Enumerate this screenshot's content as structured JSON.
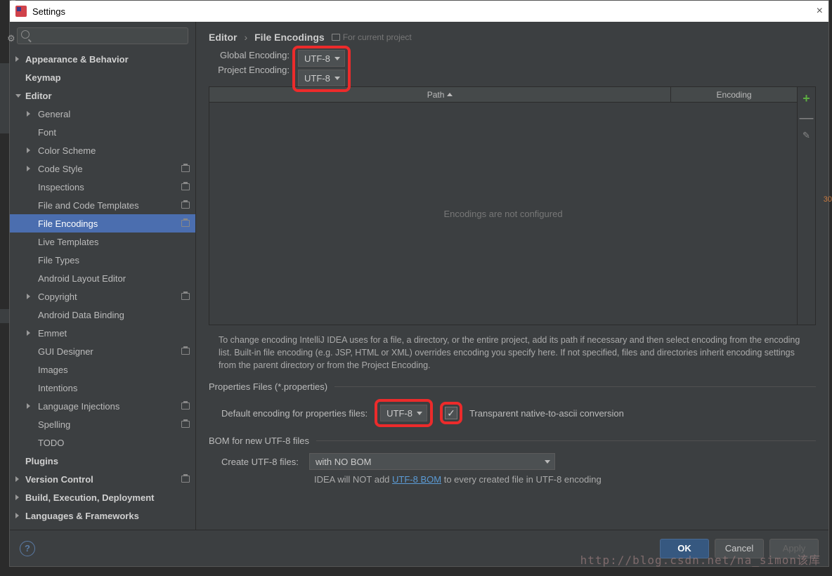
{
  "window": {
    "title": "Settings"
  },
  "search": {
    "placeholder": ""
  },
  "sidebar": {
    "items": [
      {
        "label": "Appearance & Behavior",
        "bold": true,
        "arrow": "right",
        "depth": 0
      },
      {
        "label": "Keymap",
        "bold": true,
        "depth": 0
      },
      {
        "label": "Editor",
        "bold": true,
        "arrow": "down",
        "depth": 0
      },
      {
        "label": "General",
        "arrow": "right",
        "depth": 1
      },
      {
        "label": "Font",
        "depth": 1
      },
      {
        "label": "Color Scheme",
        "arrow": "right",
        "depth": 1
      },
      {
        "label": "Code Style",
        "arrow": "right",
        "depth": 1,
        "proj": true
      },
      {
        "label": "Inspections",
        "depth": 1,
        "proj": true
      },
      {
        "label": "File and Code Templates",
        "depth": 1,
        "proj": true
      },
      {
        "label": "File Encodings",
        "depth": 1,
        "proj": true,
        "selected": true
      },
      {
        "label": "Live Templates",
        "depth": 1
      },
      {
        "label": "File Types",
        "depth": 1
      },
      {
        "label": "Android Layout Editor",
        "depth": 1
      },
      {
        "label": "Copyright",
        "arrow": "right",
        "depth": 1,
        "proj": true
      },
      {
        "label": "Android Data Binding",
        "depth": 1
      },
      {
        "label": "Emmet",
        "arrow": "right",
        "depth": 1
      },
      {
        "label": "GUI Designer",
        "depth": 1,
        "proj": true
      },
      {
        "label": "Images",
        "depth": 1
      },
      {
        "label": "Intentions",
        "depth": 1
      },
      {
        "label": "Language Injections",
        "arrow": "right",
        "depth": 1,
        "proj": true
      },
      {
        "label": "Spelling",
        "depth": 1,
        "proj": true
      },
      {
        "label": "TODO",
        "depth": 1
      },
      {
        "label": "Plugins",
        "bold": true,
        "depth": 0
      },
      {
        "label": "Version Control",
        "bold": true,
        "arrow": "right",
        "depth": 0,
        "proj": true
      },
      {
        "label": "Build, Execution, Deployment",
        "bold": true,
        "arrow": "right",
        "depth": 0
      },
      {
        "label": "Languages & Frameworks",
        "bold": true,
        "arrow": "right",
        "depth": 0
      }
    ]
  },
  "breadcrumb": {
    "editor": "Editor",
    "page": "File Encodings",
    "forcp": "For current project"
  },
  "encodings": {
    "global_label": "Global Encoding:",
    "project_label": "Project Encoding:",
    "global_value": "UTF-8",
    "project_value": "UTF-8"
  },
  "table": {
    "path_header": "Path",
    "encoding_header": "Encoding",
    "empty_message": "Encodings are not configured"
  },
  "hint": "To change encoding IntelliJ IDEA uses for a file, a directory, or the entire project, add its path if necessary and then select encoding from the encoding list. Built-in file encoding (e.g. JSP, HTML or XML) overrides encoding you specify here. If not specified, files and directories inherit encoding settings from the parent directory or from the Project Encoding.",
  "properties": {
    "title": "Properties Files (*.properties)",
    "default_label": "Default encoding for properties files:",
    "default_value": "UTF-8",
    "transparent_label": "Transparent native-to-ascii conversion"
  },
  "bom": {
    "title": "BOM for new UTF-8 files",
    "create_label": "Create UTF-8 files:",
    "create_value": "with NO BOM",
    "note_prefix": "IDEA will NOT add ",
    "note_link": "UTF-8 BOM",
    "note_suffix": " to every created file in UTF-8 encoding"
  },
  "footer": {
    "ok": "OK",
    "cancel": "Cancel",
    "apply": "Apply"
  },
  "watermark": "http://blog.csdn.net/na_simon该库",
  "orange": "30"
}
